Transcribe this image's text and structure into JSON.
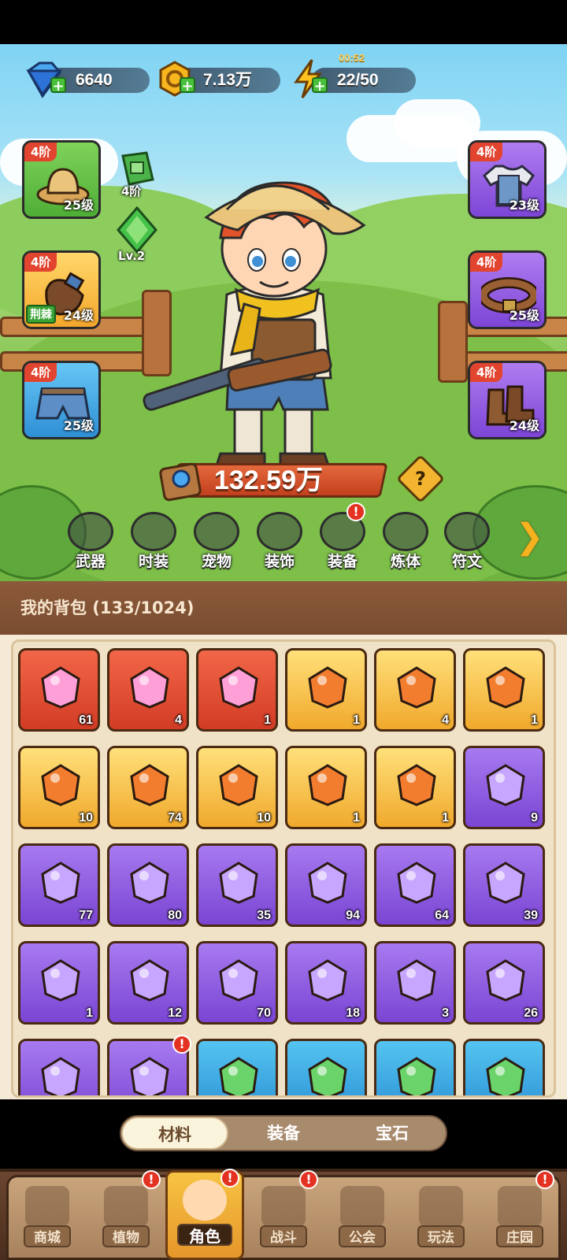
{
  "currencies": {
    "diamonds": "6640",
    "coins": "7.13万",
    "energy": "22/50",
    "energy_timer": "00:52"
  },
  "equipment_left": [
    {
      "tier": "4阶",
      "level": "25级",
      "icon": "straw-hat-icon",
      "rarity": "green"
    },
    {
      "tier": "4阶",
      "level": "24级",
      "icon": "glove-icon",
      "rarity": "orange",
      "tag": "荆棘"
    },
    {
      "tier": "4阶",
      "level": "25级",
      "icon": "shorts-icon",
      "rarity": "blue"
    }
  ],
  "equipment_right": [
    {
      "tier": "4阶",
      "level": "23级",
      "icon": "shirt-icon",
      "rarity": "purple"
    },
    {
      "tier": "4阶",
      "level": "25级",
      "icon": "belt-icon",
      "rarity": "purple"
    },
    {
      "tier": "4阶",
      "level": "24级",
      "icon": "boots-icon",
      "rarity": "purple"
    }
  ],
  "mini_items": {
    "emblem_tier": "4阶",
    "gem_level": "Lv.2"
  },
  "power": "132.59万",
  "help_label": "?",
  "menu": [
    {
      "label": "武器",
      "icon": "weapon-icon"
    },
    {
      "label": "时装",
      "icon": "outfit-icon"
    },
    {
      "label": "宠物",
      "icon": "pet-icon"
    },
    {
      "label": "装饰",
      "icon": "mask-icon"
    },
    {
      "label": "装备",
      "icon": "equipment-icon",
      "badge": "!"
    },
    {
      "label": "炼体",
      "icon": "body-icon"
    },
    {
      "label": "符文",
      "icon": "rune-icon"
    }
  ],
  "menu_more": "❯",
  "backpack": {
    "title": "我的背包 (133/1024)"
  },
  "inventory": [
    {
      "rarity": "red",
      "icon": "crystal-star-icon",
      "count": "61"
    },
    {
      "rarity": "red",
      "icon": "red-potion-icon",
      "count": "4"
    },
    {
      "rarity": "red",
      "icon": "green-tube-icon",
      "count": "1"
    },
    {
      "rarity": "gold",
      "icon": "skull-scroll-icon",
      "count": "1"
    },
    {
      "rarity": "gold",
      "icon": "key-icon",
      "count": "4"
    },
    {
      "rarity": "gold",
      "icon": "golden-fruit-icon",
      "count": "1"
    },
    {
      "rarity": "gold",
      "icon": "rune-stone-icon",
      "count": "10"
    },
    {
      "rarity": "gold",
      "icon": "orange-potion-icon",
      "count": "74"
    },
    {
      "rarity": "gold",
      "icon": "spell-book-icon",
      "count": "10"
    },
    {
      "rarity": "gold",
      "icon": "food-can-icon",
      "count": "1"
    },
    {
      "rarity": "gold",
      "icon": "orange-gem-icon",
      "count": "1"
    },
    {
      "rarity": "purple",
      "icon": "leaf-icon",
      "count": "9"
    },
    {
      "rarity": "purple",
      "icon": "scroll-green-icon",
      "count": "77"
    },
    {
      "rarity": "purple",
      "icon": "scroll-purple-icon",
      "count": "80"
    },
    {
      "rarity": "purple",
      "icon": "scroll-blue-icon",
      "count": "35"
    },
    {
      "rarity": "purple",
      "icon": "scroll-orange-icon",
      "count": "94"
    },
    {
      "rarity": "purple",
      "icon": "scroll-gold-icon",
      "count": "64"
    },
    {
      "rarity": "purple",
      "icon": "purple-potion-icon",
      "count": "39"
    },
    {
      "rarity": "purple",
      "icon": "watering-can-icon",
      "count": "1"
    },
    {
      "rarity": "purple",
      "icon": "fruit-bowl-icon",
      "count": "12"
    },
    {
      "rarity": "purple",
      "icon": "pet-food-icon",
      "count": "70"
    },
    {
      "rarity": "purple",
      "icon": "pet-puzzle-icon",
      "count": "18"
    },
    {
      "rarity": "purple",
      "icon": "purple-crystal-icon",
      "count": "3"
    },
    {
      "rarity": "purple",
      "icon": "golden-drop-icon",
      "count": "26"
    },
    {
      "rarity": "purple",
      "icon": "pink-crystal-icon",
      "count": ""
    },
    {
      "rarity": "purple",
      "icon": "mystery-egg-icon",
      "count": "",
      "badge": "!"
    },
    {
      "rarity": "blue",
      "icon": "green-orb-icon",
      "count": ""
    },
    {
      "rarity": "blue",
      "icon": "purple-orb-icon",
      "count": ""
    },
    {
      "rarity": "blue",
      "icon": "blue-orb-icon",
      "count": ""
    },
    {
      "rarity": "blue",
      "icon": "orange-orb-icon",
      "count": ""
    }
  ],
  "subtabs": [
    {
      "label": "材料",
      "active": true
    },
    {
      "label": "装备",
      "active": false
    },
    {
      "label": "宝石",
      "active": false
    }
  ],
  "nav": [
    {
      "label": "商城",
      "icon": "shop-icon"
    },
    {
      "label": "植物",
      "icon": "plant-icon",
      "badge": "!"
    },
    {
      "label": "角色",
      "icon": "character-icon",
      "badge": "!",
      "active": true
    },
    {
      "label": "战斗",
      "icon": "battle-icon",
      "badge": "!"
    },
    {
      "label": "公会",
      "icon": "guild-icon"
    },
    {
      "label": "玩法",
      "icon": "gameplay-icon"
    },
    {
      "label": "庄园",
      "icon": "manor-icon",
      "badge": "!"
    }
  ],
  "colors": {
    "rarity_red": "#d23c25",
    "rarity_gold": "#f0a92c",
    "rarity_purple": "#7a45d3",
    "rarity_blue": "#2a8fd4",
    "alert_red": "#e33222"
  }
}
